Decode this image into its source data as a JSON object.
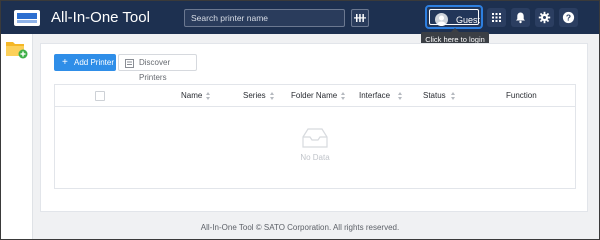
{
  "header": {
    "title": "All-In-One Tool",
    "search_placeholder": "Search printer name",
    "guest_label": "Guest",
    "tooltip": "Click here to login",
    "icons": [
      "apps-grid-icon",
      "bell-icon",
      "gear-icon",
      "help-icon"
    ]
  },
  "toolbar": {
    "add_printer": "Add Printer",
    "discover_printers": "Discover Printers"
  },
  "table": {
    "columns": [
      "Name",
      "Series",
      "Folder Name",
      "Interface",
      "Status",
      "Function"
    ],
    "rows": [],
    "empty_text": "No Data"
  },
  "footer": {
    "text": "All-In-One Tool © SATO Corporation. All rights reserved."
  },
  "colors": {
    "topbar": "#1d3050",
    "accent": "#2f8ee8",
    "guest_highlight": "#2d7fe0"
  }
}
